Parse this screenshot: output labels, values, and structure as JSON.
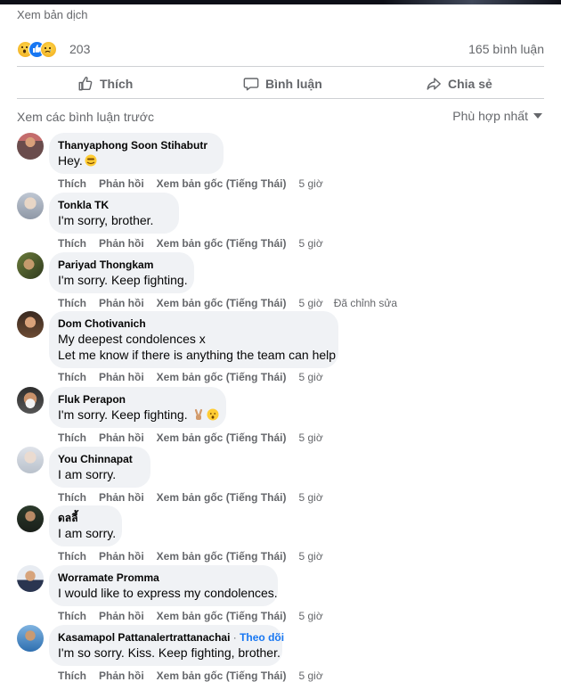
{
  "post": {
    "see_translation": "Xem bản dịch",
    "reaction_count": "203",
    "reaction_icons": [
      "wow-icon",
      "like-icon",
      "sad-icon"
    ],
    "comment_count": "165 bình luận"
  },
  "actions": {
    "like": "Thích",
    "comment": "Bình luận",
    "share": "Chia sẻ"
  },
  "comments_header": {
    "view_previous": "Xem các bình luận trước",
    "sort": "Phù hợp nhất"
  },
  "colors": {
    "secondary_text": "#65676b",
    "bubble_bg": "#f0f2f5",
    "link_blue": "#1877f2"
  },
  "comments": [
    {
      "author": "Thanyaphong Soon Stihabutr",
      "lines": [
        "Hey."
      ],
      "emoji": "hiding-face-emoji",
      "like": "Thích",
      "reply": "Phản hồi",
      "see_original": "Xem bản gốc (Tiếng Thái)",
      "time": "5 giờ"
    },
    {
      "author": "Tonkla TK",
      "lines": [
        "I'm sorry, brother."
      ],
      "like": "Thích",
      "reply": "Phản hồi",
      "see_original": "Xem bản gốc (Tiếng Thái)",
      "time": "5 giờ"
    },
    {
      "author": "Pariyad Thongkam",
      "lines": [
        "I'm sorry. Keep fighting."
      ],
      "like": "Thích",
      "reply": "Phản hồi",
      "see_original": "Xem bản gốc (Tiếng Thái)",
      "time": "5 giờ",
      "edited": "Đã chỉnh sửa"
    },
    {
      "author": "Dom Chotivanich",
      "lines": [
        "My deepest condolences x",
        "Let me know if there is anything the team can help"
      ],
      "like": "Thích",
      "reply": "Phản hồi",
      "see_original": "Xem bản gốc (Tiếng Thái)",
      "time": "5 giờ"
    },
    {
      "author": "Fluk Perapon",
      "lines": [
        "I'm sorry. Keep fighting."
      ],
      "emoji": "victory-hand-and-sad-face-emoji",
      "like": "Thích",
      "reply": "Phản hồi",
      "see_original": "Xem bản gốc (Tiếng Thái)",
      "time": "5 giờ"
    },
    {
      "author": "You Chinnapat",
      "lines": [
        "I am sorry."
      ],
      "like": "Thích",
      "reply": "Phản hồi",
      "see_original": "Xem bản gốc (Tiếng Thái)",
      "time": "5 giờ"
    },
    {
      "author": "ดลลี้",
      "lines": [
        "I am sorry."
      ],
      "like": "Thích",
      "reply": "Phản hồi",
      "see_original": "Xem bản gốc (Tiếng Thái)",
      "time": "5 giờ"
    },
    {
      "author": "Worramate Promma",
      "lines": [
        "I would like to express my condolences."
      ],
      "like": "Thích",
      "reply": "Phản hồi",
      "see_original": "Xem bản gốc (Tiếng Thái)",
      "time": "5 giờ"
    },
    {
      "author": "Kasamapol Pattanalertrattanachai",
      "follow": "Theo dõi",
      "lines": [
        "I'm so sorry. Kiss. Keep fighting, brother."
      ],
      "like": "Thích",
      "reply": "Phản hồi",
      "see_original": "Xem bản gốc (Tiếng Thái)",
      "time": "5 giờ"
    }
  ]
}
